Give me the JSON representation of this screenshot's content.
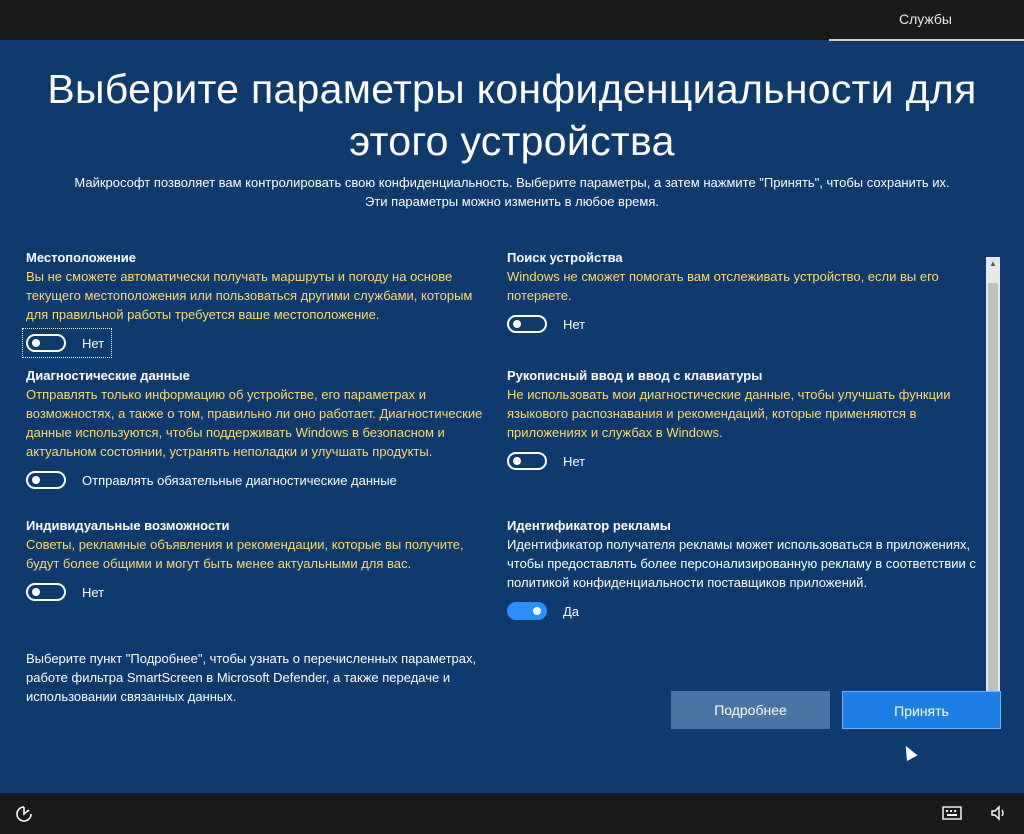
{
  "topbar": {
    "services_label": "Службы"
  },
  "header": {
    "title": "Выберите параметры конфиденциальности для этого устройства",
    "subtitle": "Майкрософт позволяет вам контролировать свою конфиденциальность. Выберите параметры, а затем нажмите \"Принять\", чтобы сохранить их. Эти параметры можно изменить в любое время."
  },
  "settings": {
    "location": {
      "title": "Местоположение",
      "description": "Вы не сможете автоматически получать маршруты и погоду на основе текущего местоположения или пользоваться другими службами, которым для правильной работы требуется ваше местоположение.",
      "toggle_label": "Нет",
      "on": false
    },
    "diagnostics": {
      "title": "Диагностические данные",
      "description": "Отправлять только информацию об устройстве, его параметрах и возможностях, а также о том, правильно ли оно работает. Диагностические данные используются, чтобы поддерживать Windows в безопасном и актуальном состоянии, устранять неполадки и улучшать продукты.",
      "toggle_label": "Отправлять обязательные диагностические данные",
      "on": false
    },
    "tailored": {
      "title": "Индивидуальные возможности",
      "description": "Советы, рекламные объявления и рекомендации, которые вы получите, будут более общими и могут быть менее актуальными для вас.",
      "toggle_label": "Нет",
      "on": false
    },
    "find_device": {
      "title": "Поиск устройства",
      "description": "Windows не сможет помогать вам отслеживать устройство, если вы его потеряете.",
      "toggle_label": "Нет",
      "on": false
    },
    "inking": {
      "title": "Рукописный ввод и ввод с клавиатуры",
      "description": "Не использовать мои диагностические данные, чтобы улучшать функции языкового распознавания и рекомендаций, которые применяются в приложениях и службах в Windows.",
      "toggle_label": "Нет",
      "on": false
    },
    "advertising": {
      "title": "Идентификатор рекламы",
      "description": "Идентификатор получателя рекламы может использоваться в приложениях, чтобы предоставлять более персонализированную рекламу в соответствии с политикой конфиденциальности поставщиков приложений.",
      "toggle_label": "Да",
      "on": true
    }
  },
  "note": "Выберите пункт \"Подробнее\", чтобы узнать о перечисленных параметрах, работе фильтра SmartScreen в Microsoft Defender, а также передаче и использовании связанных данных.",
  "buttons": {
    "more_label": "Подробнее",
    "accept_label": "Принять"
  },
  "taskbar": {
    "left_icon": "ease-of-access-icon",
    "right_icons": [
      "keyboard-icon",
      "volume-icon"
    ]
  },
  "colors": {
    "background": "#0f3a6e",
    "highlight_text": "#ffd966",
    "accept_button": "#1b7fe6",
    "more_button": "#4a74a3",
    "toggle_on": "#2a8fff"
  }
}
